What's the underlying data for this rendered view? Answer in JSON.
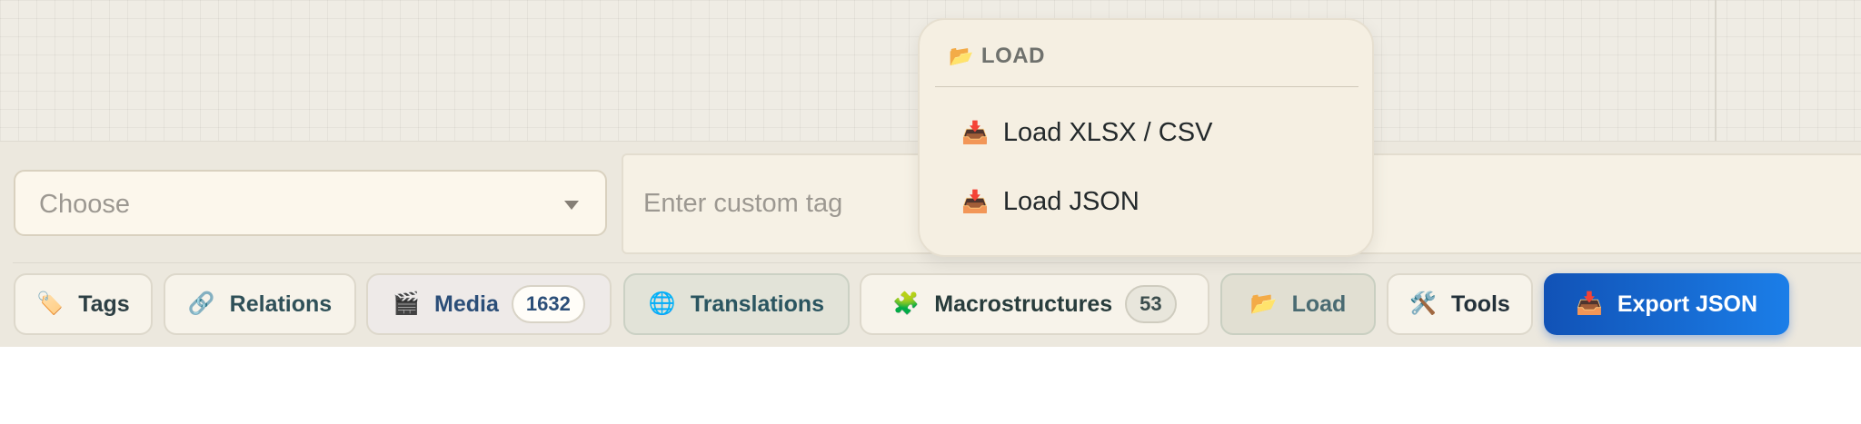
{
  "filter": {
    "select_value": "Choose",
    "tag_placeholder": "Enter custom tag"
  },
  "toolbar": {
    "tags": {
      "label": "Tags",
      "icon": "🏷️"
    },
    "relations": {
      "label": "Relations",
      "icon": "🔗"
    },
    "media": {
      "label": "Media",
      "icon": "🎬",
      "count": "1632"
    },
    "translations": {
      "label": "Translations",
      "icon": "🌐"
    },
    "macrostructures": {
      "label": "Macrostructures",
      "icon": "🧩",
      "count": "53"
    },
    "load": {
      "label": "Load",
      "icon": "📂"
    },
    "tools": {
      "label": "Tools",
      "icon": "🛠️"
    },
    "export": {
      "label": "Export JSON",
      "icon": "📥"
    }
  },
  "load_menu": {
    "title": "LOAD",
    "title_icon": "📂",
    "items": [
      {
        "label": "Load XLSX / CSV",
        "icon": "📥"
      },
      {
        "label": "Load JSON",
        "icon": "📥"
      }
    ]
  },
  "colors": {
    "accent": "#1565d8",
    "toolbar_bg": "#ece8de",
    "canvas_bg": "#efece4"
  }
}
